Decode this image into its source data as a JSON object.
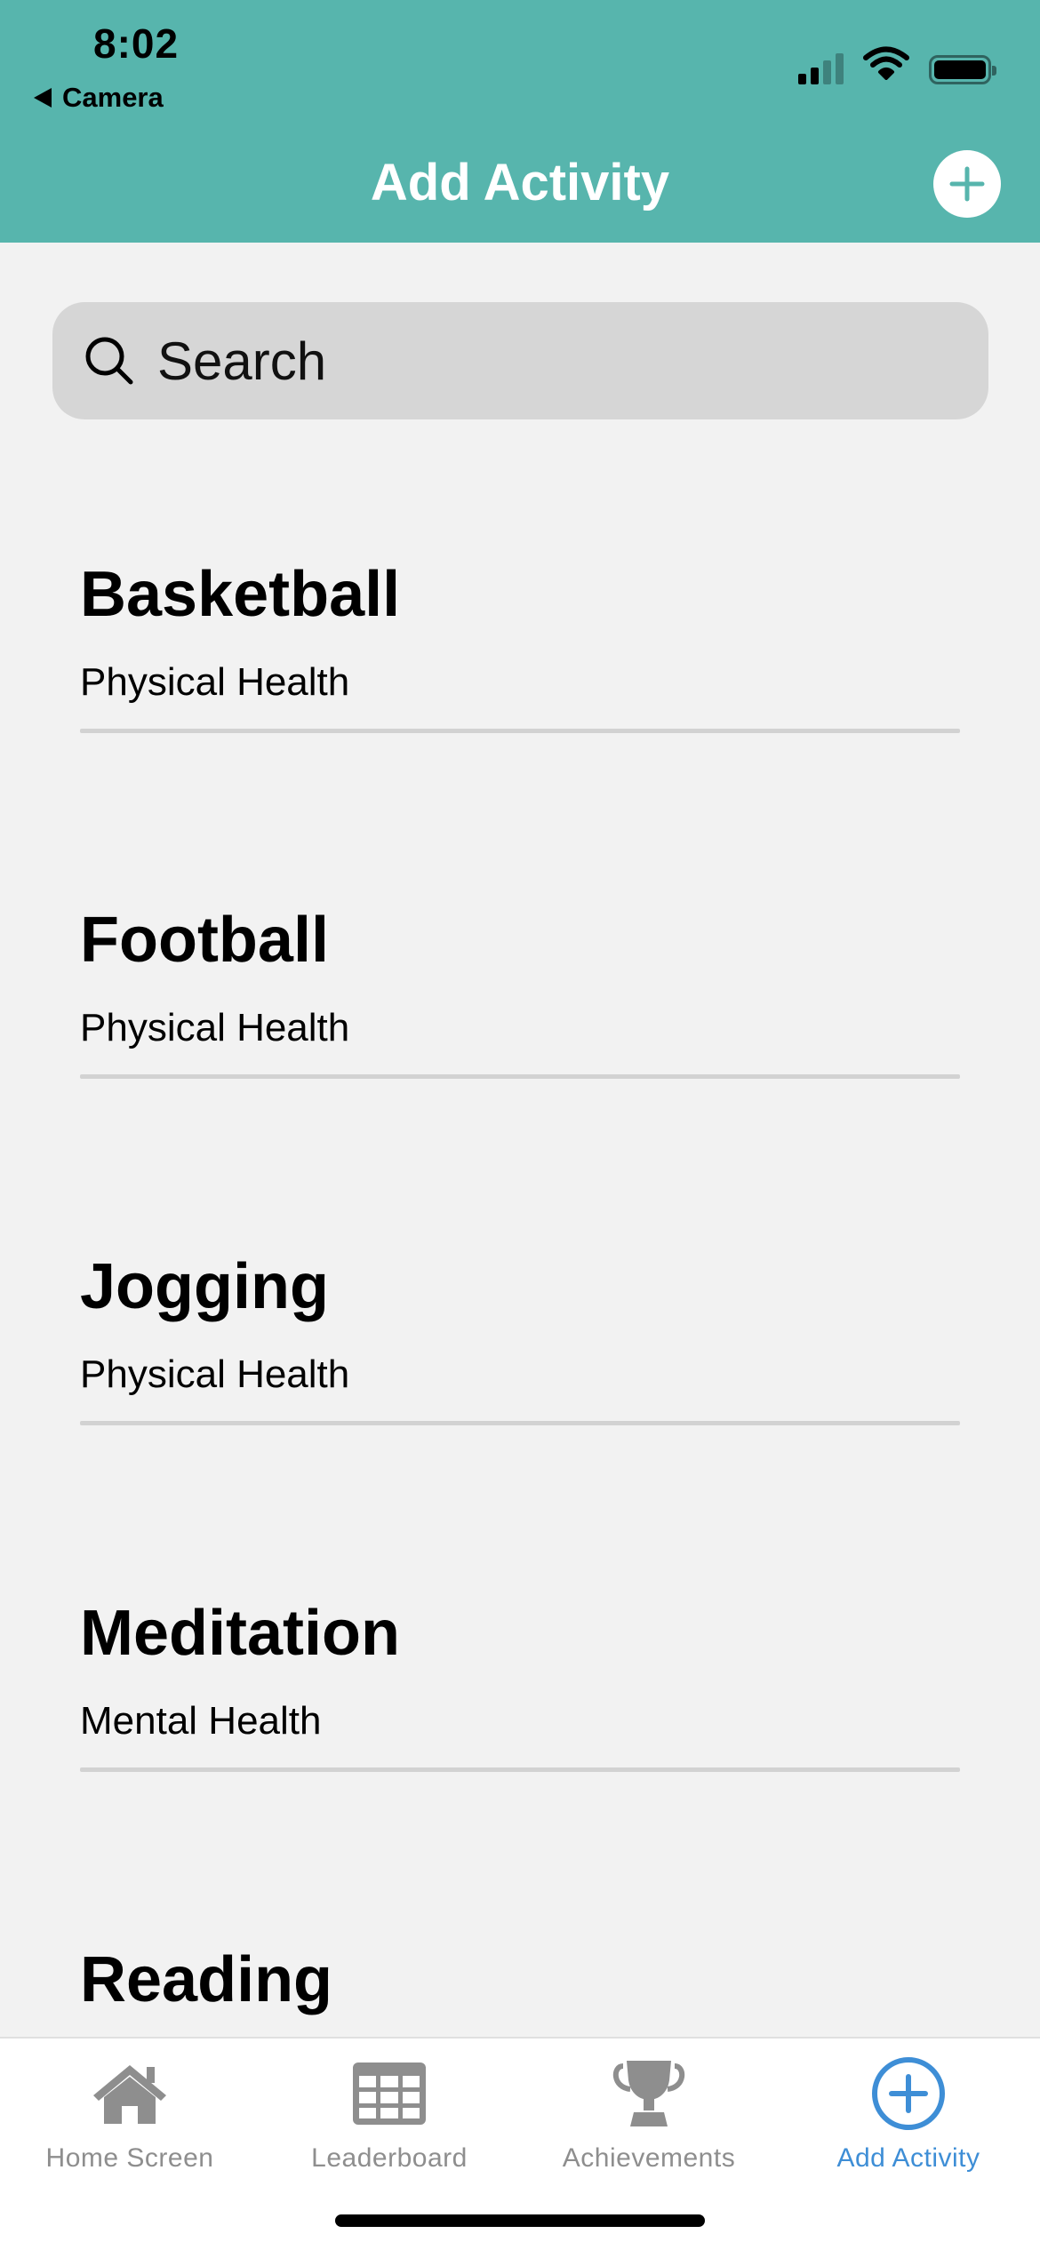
{
  "status_bar": {
    "time": "8:02",
    "back_label": "Camera"
  },
  "nav": {
    "title": "Add Activity"
  },
  "search": {
    "placeholder": "Search"
  },
  "activities": [
    {
      "name": "Basketball",
      "category": "Physical Health"
    },
    {
      "name": "Football",
      "category": "Physical Health"
    },
    {
      "name": "Jogging",
      "category": "Physical Health"
    },
    {
      "name": "Meditation",
      "category": "Mental Health"
    },
    {
      "name": "Reading",
      "category": ""
    }
  ],
  "tabs": [
    {
      "label": "Home Screen",
      "icon": "house-icon",
      "active": false
    },
    {
      "label": "Leaderboard",
      "icon": "grid-icon",
      "active": false
    },
    {
      "label": "Achievements",
      "icon": "trophy-icon",
      "active": false
    },
    {
      "label": "Add Activity",
      "icon": "plus-circle-icon",
      "active": true
    }
  ],
  "colors": {
    "header": "#57b5ad",
    "background": "#f2f2f2",
    "active_tab": "#3e8ed6",
    "inactive_tab": "#8e8e8e"
  }
}
